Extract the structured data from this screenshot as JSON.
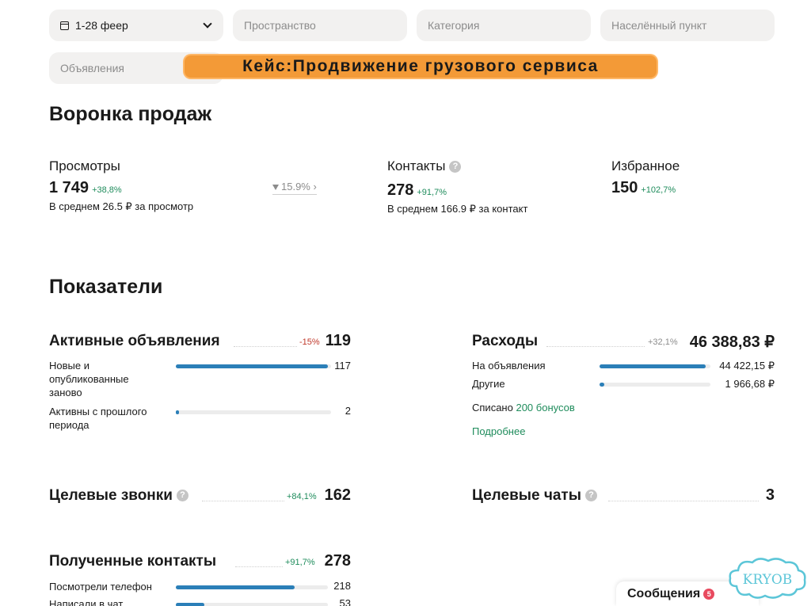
{
  "filters": {
    "date": "1-28 феер",
    "space": "Пространство",
    "category": "Категория",
    "locality": "Населённый пункт",
    "ads": "Объявления"
  },
  "banner": "Кейс:Продвижение грузового сервиса",
  "funnel": {
    "title": "Воронка продаж",
    "views": {
      "label": "Просмотры",
      "value": "1 749",
      "delta": "+38,8%",
      "avg": "В среднем 26.5 ₽ за просмотр",
      "conversion": "15.9%"
    },
    "contacts": {
      "label": "Контакты",
      "value": "278",
      "delta": "+91,7%",
      "avg": "В среднем 166.9 ₽ за контакт"
    },
    "favorites": {
      "label": "Избранное",
      "value": "150",
      "delta": "+102,7%"
    }
  },
  "indicators": {
    "title": "Показатели",
    "active_ads": {
      "title": "Активные объявления",
      "delta": "-15%",
      "value": "119",
      "rows": [
        {
          "label": "Новые и опубликованные заново",
          "value": "117",
          "fraction": 0.98
        },
        {
          "label": "Активны с прошлого периода",
          "value": "2",
          "fraction": 0.02
        }
      ]
    },
    "expenses": {
      "title": "Расходы",
      "delta": "+32,1%",
      "value": "46 388,83 ₽",
      "rows": [
        {
          "label": "На объявления",
          "value": "44 422,15 ₽",
          "fraction": 0.96
        },
        {
          "label": "Другие",
          "value": "1 966,68 ₽",
          "fraction": 0.04
        }
      ],
      "bonus_prefix": "Списано",
      "bonus_link": "200 бонусов",
      "more_link": "Подробнее"
    },
    "target_calls": {
      "title": "Целевые звонки",
      "delta": "+84,1%",
      "value": "162"
    },
    "target_chats": {
      "title": "Целевые чаты",
      "value": "3"
    },
    "received_contacts": {
      "title": "Полученные контакты",
      "delta": "+91,7%",
      "value": "278",
      "rows": [
        {
          "label": "Посмотрели телефон",
          "value": "218",
          "fraction": 0.78
        },
        {
          "label": "Написали в чат",
          "value": "53",
          "fraction": 0.19
        }
      ]
    }
  },
  "messages": {
    "label": "Сообщения",
    "badge": "5"
  },
  "logo_text": "KRYOB",
  "colors": {
    "accent": "#2b7fb8",
    "positive": "#1f8c5c",
    "negative": "#c0392b",
    "banner": "#f39a37"
  }
}
